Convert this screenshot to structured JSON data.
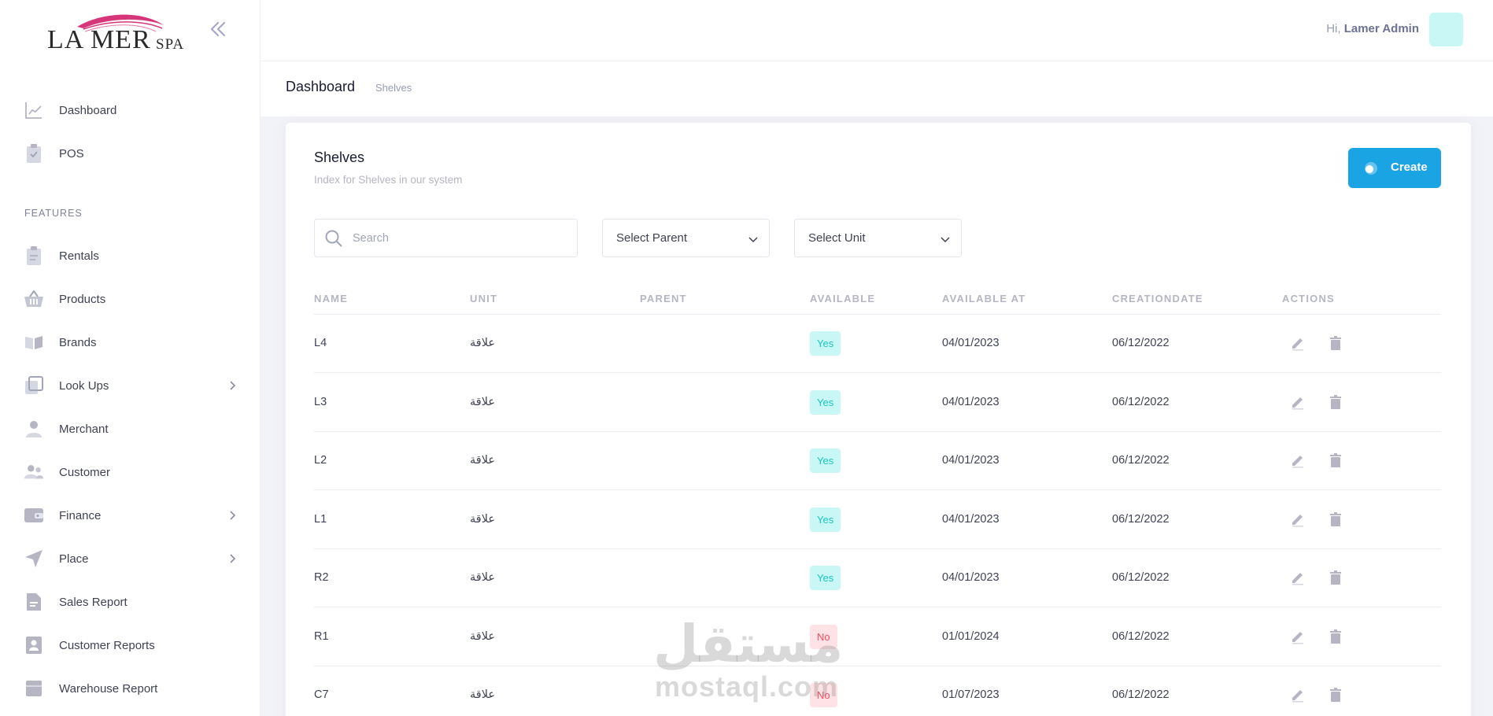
{
  "brand": {
    "logo_main": "LA MER",
    "logo_spa": "SPA",
    "logo_script": "lamer"
  },
  "sidebar": {
    "top_items": [
      {
        "label": "Dashboard",
        "icon": "chart-line-icon"
      },
      {
        "label": "POS",
        "icon": "clipboard-check-icon"
      }
    ],
    "section_label": "FEATURES",
    "items": [
      {
        "label": "Rentals",
        "icon": "clipboard-icon",
        "has_submenu": false
      },
      {
        "label": "Products",
        "icon": "basket-icon",
        "has_submenu": false
      },
      {
        "label": "Brands",
        "icon": "book-open-icon",
        "has_submenu": false
      },
      {
        "label": "Look Ups",
        "icon": "layers-icon",
        "has_submenu": true
      },
      {
        "label": "Merchant",
        "icon": "user-icon",
        "has_submenu": false
      },
      {
        "label": "Customer",
        "icon": "users-icon",
        "has_submenu": false
      },
      {
        "label": "Finance",
        "icon": "wallet-icon",
        "has_submenu": true
      },
      {
        "label": "Place",
        "icon": "navigation-icon",
        "has_submenu": true
      },
      {
        "label": "Sales Report",
        "icon": "file-report-icon",
        "has_submenu": false
      },
      {
        "label": "Customer Reports",
        "icon": "contact-card-icon",
        "has_submenu": false
      },
      {
        "label": "Warehouse Report",
        "icon": "archive-icon",
        "has_submenu": false
      }
    ]
  },
  "header": {
    "greeting": "Hi,",
    "user_name": "Lamer Admin"
  },
  "breadcrumb": {
    "title": "Dashboard",
    "current": "Shelves"
  },
  "card": {
    "title": "Shelves",
    "description": "Index for Shelves in our system",
    "create_label": "Create"
  },
  "filters": {
    "search_placeholder": "Search",
    "parent_select": "Select Parent",
    "unit_select": "Select Unit"
  },
  "table": {
    "columns": [
      "NAME",
      "UNIT",
      "PARENT",
      "AVAILABLE",
      "AVAILABLE AT",
      "CREATIONDATE",
      "ACTIONS"
    ],
    "rows": [
      {
        "name": "L4",
        "unit": "علاقة",
        "parent": "",
        "available": "Yes",
        "available_at": "04/01/2023",
        "creation_date": "06/12/2022"
      },
      {
        "name": "L3",
        "unit": "علاقة",
        "parent": "",
        "available": "Yes",
        "available_at": "04/01/2023",
        "creation_date": "06/12/2022"
      },
      {
        "name": "L2",
        "unit": "علاقة",
        "parent": "",
        "available": "Yes",
        "available_at": "04/01/2023",
        "creation_date": "06/12/2022"
      },
      {
        "name": "L1",
        "unit": "علاقة",
        "parent": "",
        "available": "Yes",
        "available_at": "04/01/2023",
        "creation_date": "06/12/2022"
      },
      {
        "name": "R2",
        "unit": "علاقة",
        "parent": "",
        "available": "Yes",
        "available_at": "04/01/2023",
        "creation_date": "06/12/2022"
      },
      {
        "name": "R1",
        "unit": "علاقة",
        "parent": "",
        "available": "No",
        "available_at": "01/01/2024",
        "creation_date": "06/12/2022"
      },
      {
        "name": "C7",
        "unit": "علاقة",
        "parent": "",
        "available": "No",
        "available_at": "01/07/2023",
        "creation_date": "06/12/2022"
      }
    ]
  },
  "watermark": {
    "arabic": "مستقل",
    "latin": "mostaql.com"
  },
  "colors": {
    "primary": "#1ba4e3",
    "yes_bg": "#c9f7f5",
    "yes_text": "#1bc5bd",
    "no_bg": "#ffe2e5",
    "no_text": "#f64e60",
    "avatar": "#c9f7f5"
  }
}
